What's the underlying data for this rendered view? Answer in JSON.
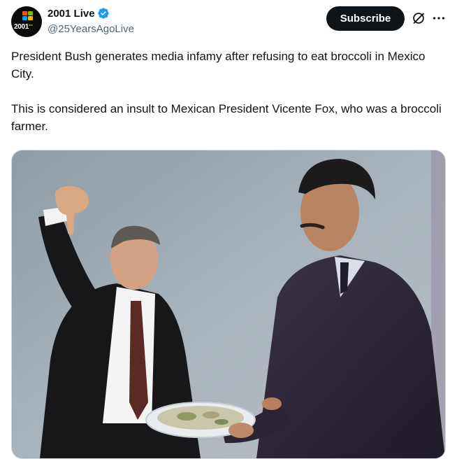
{
  "account": {
    "display_name": "2001 Live",
    "handle": "@25YearsAgoLive",
    "verified": true,
    "avatar_text": "2001"
  },
  "actions": {
    "subscribe_label": "Subscribe",
    "grok_icon": "grok-icon",
    "more_icon": "more-icon"
  },
  "tweet": {
    "paragraphs": [
      "President Bush generates media infamy after refusing to eat broccoli in Mexico City.",
      "This is considered an insult to Mexican President Vicente Fox, who was a broccoli farmer."
    ]
  },
  "colors": {
    "text": "#0f1419",
    "secondary_text": "#536471",
    "verified_blue": "#1d9bf0",
    "subscribe_bg": "#0f1419"
  }
}
